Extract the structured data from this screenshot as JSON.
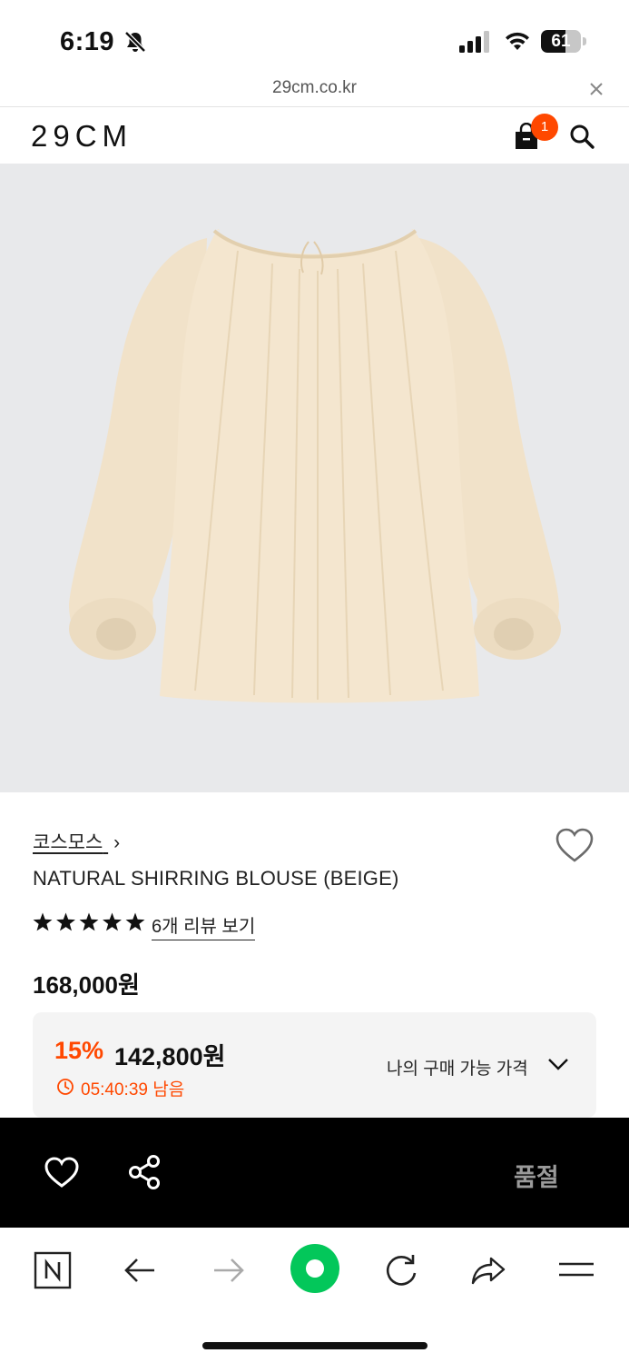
{
  "status_bar": {
    "time": "6:19",
    "battery_percent": "61",
    "battery_level": 0.61
  },
  "browser": {
    "url": "29cm.co.kr"
  },
  "header": {
    "logo": "29CM",
    "cart_count": "1"
  },
  "product": {
    "brand": "코스모스",
    "brand_chevron": "›",
    "name": "NATURAL SHIRRING BLOUSE (BEIGE)",
    "rating": 5,
    "review_link": "6개 리뷰 보기",
    "original_price": "168,000원",
    "discount_rate": "15%",
    "sale_price": "142,800원",
    "timer": "05:40:39 남음",
    "my_price_label": "나의 구매 가능 가격"
  },
  "action_bar": {
    "soldout_label": "품절"
  },
  "colors": {
    "accent": "#ff4800",
    "naver_green": "#03c75a",
    "action_bar_bg": "#000000",
    "image_bg": "#e8e9eb",
    "blouse": "#f4e6cf"
  },
  "icons": [
    "bell-slash-icon",
    "signal-icon",
    "wifi-icon",
    "battery-icon",
    "close-icon",
    "shopping-bag-icon",
    "search-icon",
    "heart-outline-icon",
    "star-icon",
    "clock-icon",
    "chevron-down-icon",
    "share-icon",
    "naver-home-icon",
    "back-arrow-icon",
    "forward-arrow-icon",
    "refresh-icon",
    "share-arrow-icon",
    "menu-icon"
  ]
}
